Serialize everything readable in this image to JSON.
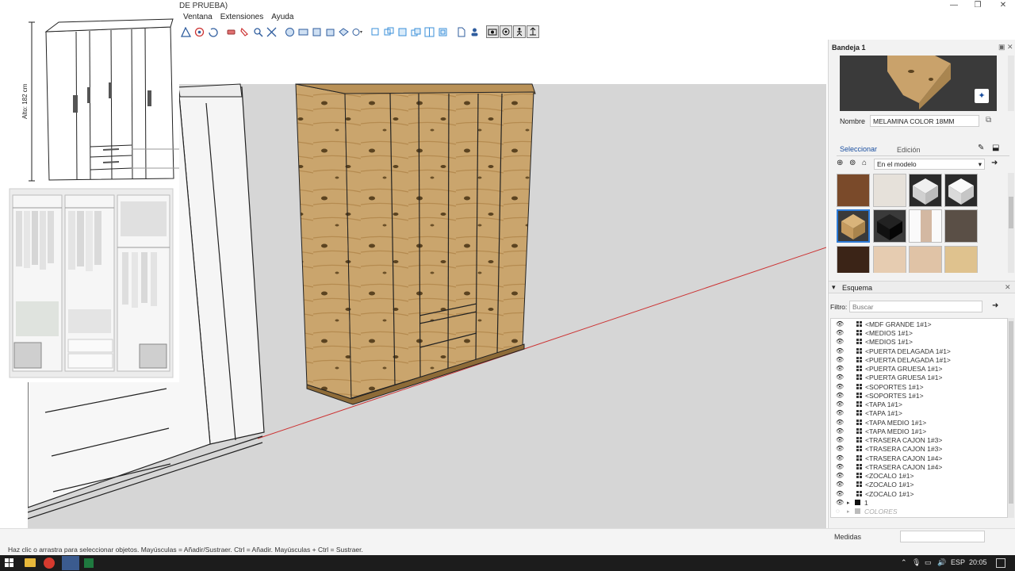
{
  "app": {
    "window_title": "DE PRUEBA)"
  },
  "menu": [
    "Ventana",
    "Extensiones",
    "Ayuda"
  ],
  "overlay": {
    "dimension_label": "Alto: 182 cm"
  },
  "materials_panel": {
    "tray_title": "Bandeja 1",
    "name_label": "Nombre",
    "name_value": "MELAMINA COLOR 18MM",
    "tab_select": "Seleccionar",
    "tab_edit": "Edición",
    "collection_value": "En el modelo"
  },
  "outliner": {
    "title": "Esquema",
    "filter_label": "Filtro:",
    "filter_placeholder": "Buscar",
    "items": [
      "<MDF GRANDE 1#1>",
      "<MEDIOS 1#1>",
      "<MEDIOS 1#1>",
      "<PUERTA DELAGADA 1#1>",
      "<PUERTA DELAGADA 1#1>",
      "<PUERTA GRUESA 1#1>",
      "<PUERTA GRUESA 1#1>",
      "<SOPORTES 1#1>",
      "<SOPORTES 1#1>",
      "<TAPA 1#1>",
      "<TAPA 1#1>",
      "<TAPA MEDIO 1#1>",
      "<TAPA MEDIO 1#1>",
      "<TRASERA CAJON 1#3>",
      "<TRASERA CAJON 1#3>",
      "<TRASERA CAJON 1#4>",
      "<TRASERA CAJON 1#4>",
      "<ZOCALO 1#1>",
      "<ZOCALO 1#1>",
      "<ZOCALO 1#1>"
    ],
    "group_1": "1",
    "group_2": "COLORES"
  },
  "measurements": {
    "label": "Medidas",
    "value": ""
  },
  "status": {
    "hint": "Haz clic o arrastra para seleccionar objetos. Mayúsculas = Añadir/Sustraer. Ctrl = Añadir. Mayúsculas + Ctrl = Sustraer."
  },
  "taskbar": {
    "lang": "ESP",
    "time": "20:05"
  },
  "colors": {
    "wood": "#c9a26b",
    "wood_dark": "#7a5a2e",
    "axis_red": "#cc3333",
    "viewport_ground": "#d6d6d6"
  }
}
